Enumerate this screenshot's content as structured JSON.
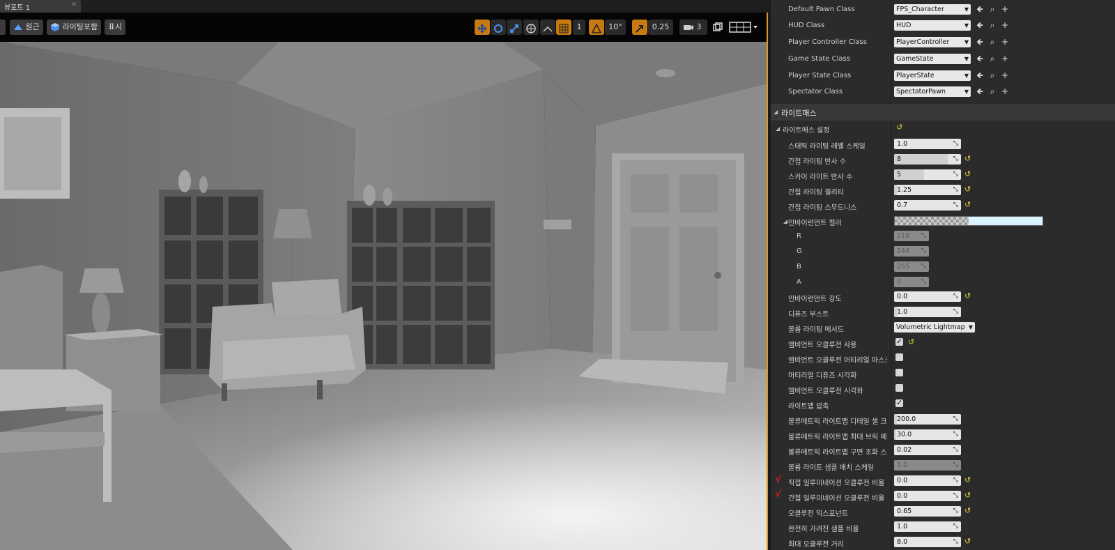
{
  "viewport": {
    "tab_label": "뷰포트 1",
    "tab_close": "×",
    "toolbar": {
      "perspective_label": "원근",
      "lighting_label": "라이팅포함",
      "show_label": "표시",
      "grid_value": "1",
      "angle_value": "10°",
      "scale_value": "0.25",
      "camera_speed": "3"
    }
  },
  "details": {
    "game_mode_rows": [
      {
        "label": "Default Pawn Class",
        "value": "FPS_Character"
      },
      {
        "label": "HUD Class",
        "value": "HUD"
      },
      {
        "label": "Player Controller Class",
        "value": "PlayerController"
      },
      {
        "label": "Game State Class",
        "value": "GameState"
      },
      {
        "label": "Player State Class",
        "value": "PlayerState"
      },
      {
        "label": "Spectator Class",
        "value": "SpectatorPawn"
      }
    ],
    "lightmass_category": "라이트매스",
    "lightmass_settings_label": "라이트매스 설정",
    "rows": {
      "static_lighting_level_scale": {
        "label": "스태틱 라이팅 레벨 스케일",
        "value": "1.0",
        "fill": 0
      },
      "indirect_bounces": {
        "label": "간접 라이팅 반사 수",
        "value": "8",
        "fill": 0.8
      },
      "skylight_bounces": {
        "label": "스카이 라이트 반사 수",
        "value": "5",
        "fill": 0.45
      },
      "indirect_quality": {
        "label": "간접 라이팅 퀄리티",
        "value": "1.25",
        "fill": 0.04
      },
      "indirect_smoothness": {
        "label": "간접 라이팅 스무드니스",
        "value": "0.7",
        "fill": 0
      },
      "env_color": {
        "label": "인바이런먼트 컬러",
        "color": "#daf4ff"
      },
      "r": {
        "label": "R",
        "value": "218"
      },
      "g": {
        "label": "G",
        "value": "244"
      },
      "b": {
        "label": "B",
        "value": "255"
      },
      "a": {
        "label": "A",
        "value": "0"
      },
      "env_intensity": {
        "label": "인바이런먼트 강도",
        "value": "0.0",
        "fill": 0
      },
      "diffuse_boost": {
        "label": "디퓨즈 부스트",
        "value": "1.0",
        "fill": 0.04
      },
      "volume_method": {
        "label": "볼륨 라이팅 메서드",
        "value": "Volumetric Lightmap"
      },
      "use_ao": {
        "label": "앰비언트 오클루전 사용",
        "checked": true
      },
      "ao_material_mask": {
        "label": "앰비언트 오클루전 머티리얼 마스크",
        "checked": false
      },
      "material_diffuse_vis": {
        "label": "머티리얼 디퓨즈 시각화",
        "checked": false
      },
      "ao_vis": {
        "label": "앰비언트 오클루전 시각화",
        "checked": false
      },
      "lightmap_compress": {
        "label": "라이트맵 압축",
        "checked": true
      },
      "vlm_detail_cell": {
        "label": "볼류메트릭 라이트맵 디테일 셀 크기",
        "value": "200.0",
        "fill": 0.04
      },
      "vlm_max_brick": {
        "label": "볼류메트릭 라이트맵 최대 브릭 메모리",
        "value": "30.0",
        "fill": 0.03
      },
      "vlm_sh_ringing": {
        "label": "볼류메트릭 라이트맵 구면 조화 스무딩",
        "value": "0.02",
        "fill": 0
      },
      "volume_light_sample": {
        "label": "볼륨 라이트 샘플 배치 스케일",
        "value": "1.0"
      },
      "direct_occlusion": {
        "label": "직접 일루미네이션 오클루전 비율",
        "value": "0.0",
        "fill": 0
      },
      "indirect_occlusion": {
        "label": "간접 일루미네이션 오클루전 비율",
        "value": "0.0",
        "fill": 0
      },
      "occlusion_exponent": {
        "label": "오클루전 익스포넌트",
        "value": "0.65",
        "fill": 0
      },
      "fully_occluded_fraction": {
        "label": "완전히 가려진 샘플 비율",
        "value": "1.0",
        "fill": 0
      },
      "max_occlusion_distance": {
        "label": "최대 오클루전 거리",
        "value": "8.0",
        "fill": 0
      }
    },
    "annotation_mark": "√"
  }
}
